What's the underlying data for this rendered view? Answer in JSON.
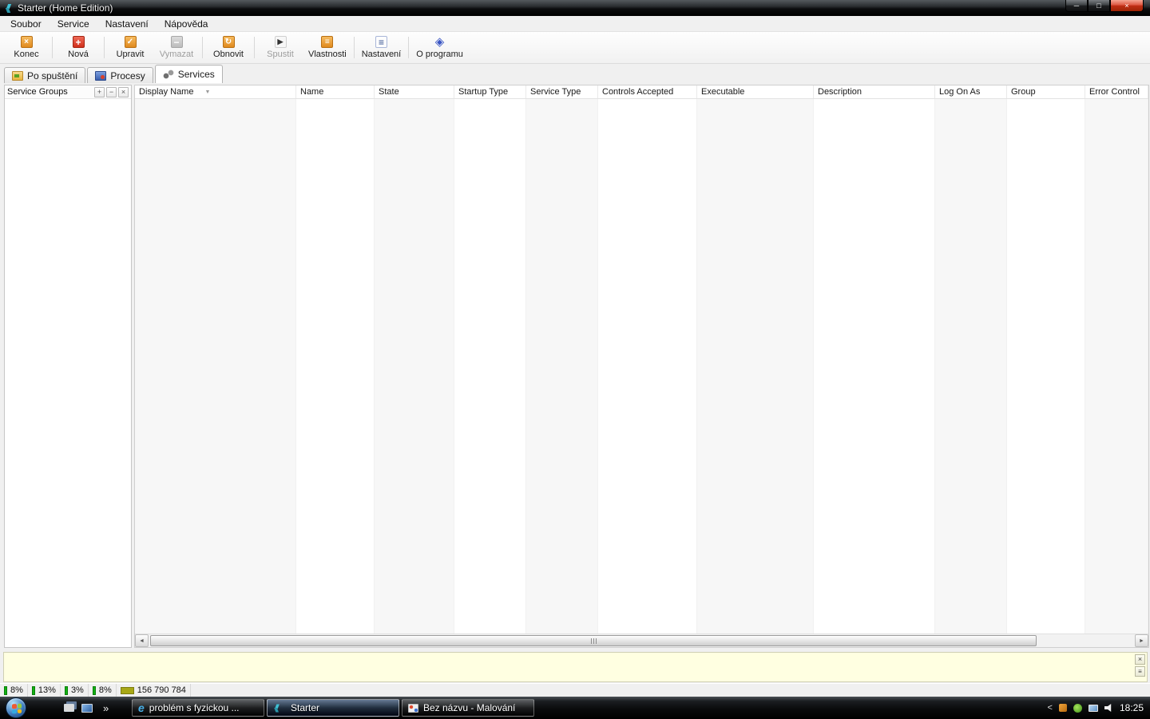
{
  "window": {
    "title": "Starter (Home Edition)",
    "controls": {
      "minimize": "─",
      "maximize": "□",
      "close": "×"
    }
  },
  "menu": {
    "items": [
      "Soubor",
      "Service",
      "Nastavení",
      "Nápověda"
    ]
  },
  "toolbar": {
    "buttons": [
      {
        "label": "Konec",
        "glyph": "×",
        "enabled": true
      },
      {
        "label": "Nová",
        "glyph": "+",
        "enabled": true
      },
      {
        "label": "Upravit",
        "glyph": "✓",
        "enabled": true
      },
      {
        "label": "Vymazat",
        "glyph": "−",
        "enabled": false
      },
      {
        "label": "Obnovit",
        "glyph": "↻",
        "enabled": true
      },
      {
        "label": "Spustit",
        "glyph": "▶",
        "enabled": false
      },
      {
        "label": "Vlastnosti",
        "glyph": "≡",
        "enabled": true
      },
      {
        "label": "Nastavení",
        "glyph": "≡",
        "enabled": true
      },
      {
        "label": "O programu",
        "glyph": "◈",
        "enabled": true
      }
    ]
  },
  "tabs": [
    {
      "label": "Po spuštění",
      "active": false
    },
    {
      "label": "Procesy",
      "active": false
    },
    {
      "label": "Services",
      "active": true
    }
  ],
  "sidebar": {
    "title": "Service Groups",
    "expand_glyph": "+",
    "collapse_glyph": "−",
    "close_glyph": "×"
  },
  "table": {
    "columns": [
      "Display Name",
      "Name",
      "State",
      "Startup Type",
      "Service Type",
      "Controls Accepted",
      "Executable",
      "Description",
      "Log On As",
      "Group",
      "Error Control"
    ],
    "sort_glyph": "▼"
  },
  "scrollbar": {
    "left_glyph": "◄",
    "right_glyph": "►"
  },
  "note_panel": {
    "close_glyph": "×",
    "menu_glyph": "≡"
  },
  "statusbar": {
    "cells": [
      {
        "value": "8%"
      },
      {
        "value": "13%"
      },
      {
        "value": "3%"
      },
      {
        "value": "8%"
      },
      {
        "value": "156 790 784"
      }
    ]
  },
  "taskbar": {
    "quick_launch_chevron": "»",
    "buttons": [
      {
        "label": "problém s fyzickou ...",
        "active": false
      },
      {
        "label": "Starter",
        "active": true
      },
      {
        "label": "Bez názvu - Malování",
        "active": false
      }
    ],
    "tray_chevron": "<",
    "clock": "18:25"
  }
}
